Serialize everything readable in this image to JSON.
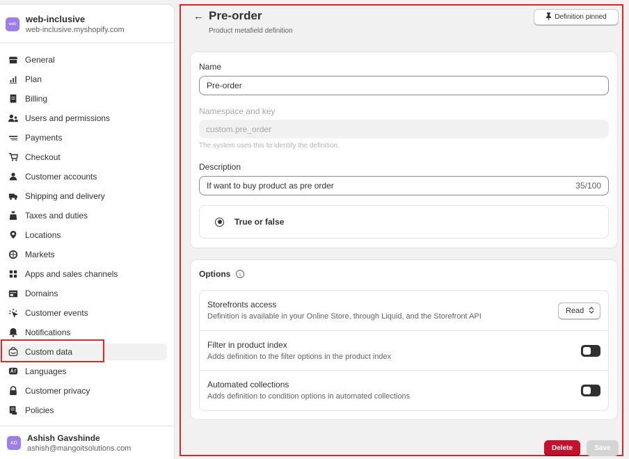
{
  "store": {
    "avatar": "web",
    "name": "web-inclusive",
    "domain": "web-inclusive.myshopify.com"
  },
  "nav": [
    {
      "label": "General",
      "icon": "store-icon"
    },
    {
      "label": "Plan",
      "icon": "chart-icon"
    },
    {
      "label": "Billing",
      "icon": "receipt-icon"
    },
    {
      "label": "Users and permissions",
      "icon": "users-icon"
    },
    {
      "label": "Payments",
      "icon": "payments-icon"
    },
    {
      "label": "Checkout",
      "icon": "cart-icon"
    },
    {
      "label": "Customer accounts",
      "icon": "person-icon"
    },
    {
      "label": "Shipping and delivery",
      "icon": "truck-icon"
    },
    {
      "label": "Taxes and duties",
      "icon": "tax-icon"
    },
    {
      "label": "Locations",
      "icon": "location-icon"
    },
    {
      "label": "Markets",
      "icon": "globe-icon"
    },
    {
      "label": "Apps and sales channels",
      "icon": "apps-icon"
    },
    {
      "label": "Domains",
      "icon": "domain-icon"
    },
    {
      "label": "Customer events",
      "icon": "cursor-icon"
    },
    {
      "label": "Notifications",
      "icon": "bell-icon"
    },
    {
      "label": "Custom data",
      "icon": "database-icon",
      "active": true
    },
    {
      "label": "Languages",
      "icon": "language-icon"
    },
    {
      "label": "Customer privacy",
      "icon": "lock-icon"
    },
    {
      "label": "Policies",
      "icon": "policy-icon"
    }
  ],
  "user": {
    "avatar": "AG",
    "name": "Ashish Gavshinde",
    "email": "ashish@mangoitsolutions.com"
  },
  "header": {
    "back": "←",
    "title": "Pre-order",
    "subtitle": "Product metafield definition",
    "pin_label": "Definition pinned"
  },
  "form": {
    "name_label": "Name",
    "name_value": "Pre-order",
    "namespace_label": "Namespace and key",
    "namespace_value": "custom.pre_order",
    "namespace_help": "The system uses this to identify the definition.",
    "description_label": "Description",
    "description_value": "If want to buy product as pre order",
    "description_counter": "35/100",
    "type_label": "True or false"
  },
  "options": {
    "title": "Options",
    "info": "i",
    "rows": [
      {
        "name": "Storefronts access",
        "desc": "Definition is available in your Online Store, through Liquid, and the Storefront API",
        "control": "select",
        "value": "Read"
      },
      {
        "name": "Filter in product index",
        "desc": "Adds definition to the filter options in the product index",
        "control": "toggle"
      },
      {
        "name": "Automated collections",
        "desc": "Adds definition to condition options in automated collections",
        "control": "toggle"
      }
    ]
  },
  "actions": {
    "delete": "Delete",
    "save": "Save"
  },
  "colors": {
    "accent_red": "#c5112b",
    "highlight_border": "#d8252b",
    "avatar": "#9b7ee6"
  }
}
